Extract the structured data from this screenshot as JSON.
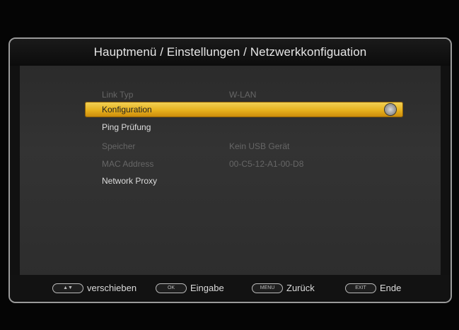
{
  "title": "Hauptmenü / Einstellungen / Netzwerkkonfiguation",
  "menu": [
    {
      "label": "Link Typ",
      "value": "W-LAN",
      "state": "disabled"
    },
    {
      "label": "Konfiguration",
      "value": "",
      "state": "selected",
      "icon": "settings-disc-icon"
    },
    {
      "label": "Ping  Prüfung",
      "value": "",
      "state": "enabled"
    },
    {
      "label": "Speicher",
      "value": "Kein USB Gerät",
      "state": "disabled"
    },
    {
      "label": "MAC Address",
      "value": "00-C5-12-A1-00-D8",
      "state": "disabled"
    },
    {
      "label": "Network Proxy",
      "value": "",
      "state": "enabled"
    }
  ],
  "footer": {
    "move_key": "▲▼",
    "move_label": "verschieben",
    "ok_key": "OK",
    "ok_label": "Eingabe",
    "menu_key": "MENU",
    "menu_label": "Zurück",
    "exit_key": "EXIT",
    "exit_label": "Ende"
  }
}
